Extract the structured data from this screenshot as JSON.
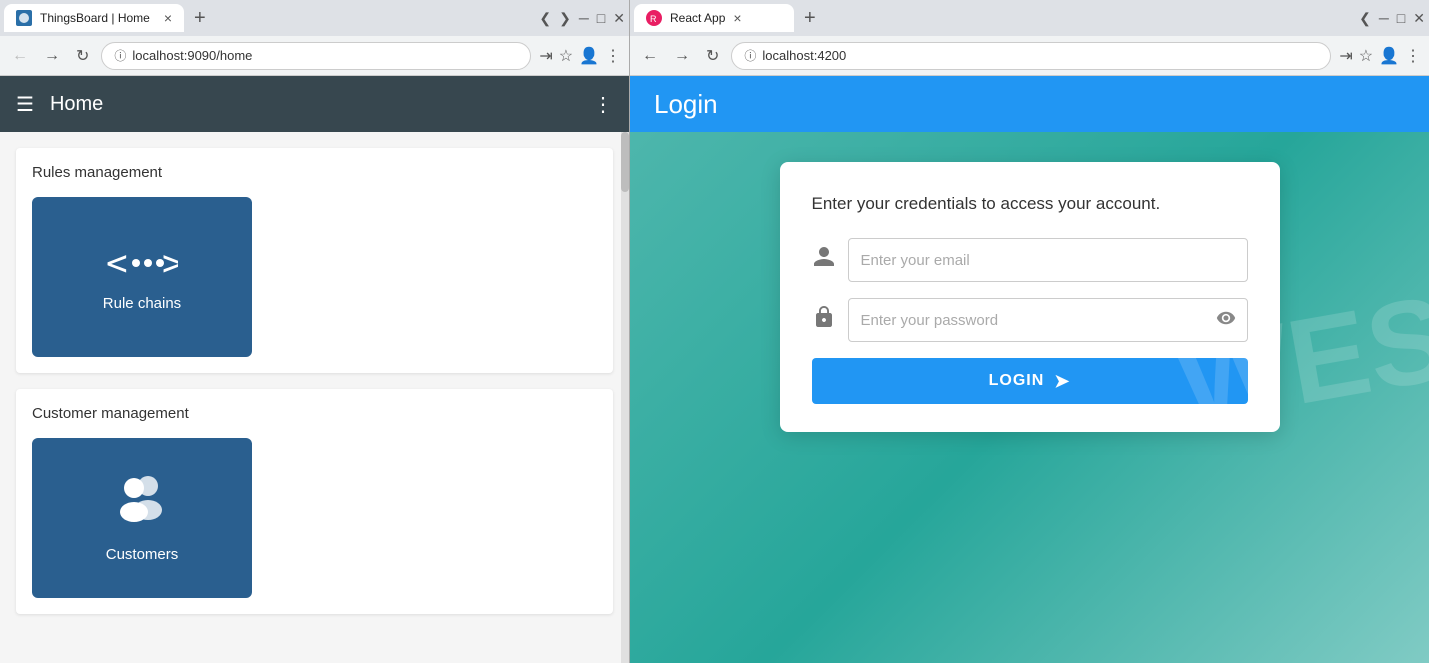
{
  "leftBrowser": {
    "tab": {
      "favicon_color": "#2a6fa8",
      "title": "ThingsBoard | Home",
      "close": "×"
    },
    "new_tab_icon": "+",
    "tab_controls": [
      "❮",
      "❯",
      "⋮"
    ],
    "address": {
      "back": "←",
      "forward": "→",
      "reload": "↻",
      "url": "localhost:9090/home",
      "bookmark": "☆",
      "profile": "👤",
      "more": "⋮"
    },
    "app": {
      "header": {
        "menu_icon": "☰",
        "title": "Home",
        "more_icon": "⋮"
      },
      "sections": [
        {
          "title": "Rules management",
          "tiles": [
            {
              "label": "Rule chains",
              "type": "rule-chains"
            }
          ]
        },
        {
          "title": "Customer management",
          "tiles": [
            {
              "label": "Customers",
              "type": "customers"
            }
          ]
        }
      ]
    }
  },
  "rightBrowser": {
    "tab": {
      "title": "React App",
      "close": "×"
    },
    "new_tab_icon": "+",
    "address": {
      "back": "←",
      "forward": "→",
      "reload": "↻",
      "url": "localhost:4200",
      "bookmark": "☆",
      "profile": "👤",
      "more": "⋮"
    },
    "app": {
      "header_title": "Login",
      "card": {
        "subtitle": "Enter your credentials to access your account.",
        "email_placeholder": "Enter your email",
        "password_placeholder": "Enter your password",
        "login_button": "LOGIN"
      }
    }
  }
}
